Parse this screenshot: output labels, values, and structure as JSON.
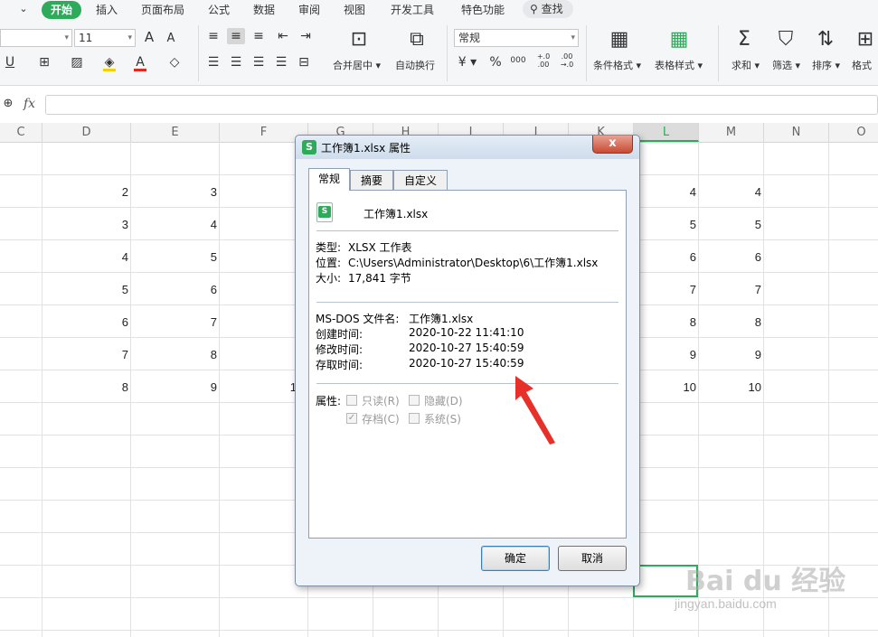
{
  "menu": {
    "tabs": [
      "开始",
      "插入",
      "页面布局",
      "公式",
      "数据",
      "审阅",
      "视图",
      "开发工具",
      "特色功能"
    ],
    "search": "查找"
  },
  "ribbon": {
    "font_size": "11",
    "number_format": "常规",
    "merge_center": "合并居中",
    "wrap_text": "自动换行",
    "currency_symbol": "¥",
    "percent_symbol": "%",
    "thousands_symbol": "000",
    "cond_format": "条件格式",
    "table_style": "表格样式",
    "sum": "求和",
    "filter": "筛选",
    "sort": "排序",
    "format": "格式",
    "font_grow": "A",
    "font_shrink": "A",
    "font_color_letter": "A",
    "decimal_inc": "+.0\n.00",
    "decimal_dec": ".00\n→.0"
  },
  "formula_bar": {
    "fx": "fx"
  },
  "grid": {
    "columns": [
      "C",
      "D",
      "E",
      "F",
      "G",
      "H",
      "I",
      "J",
      "K",
      "L",
      "M",
      "N",
      "O"
    ],
    "selected_column": "L",
    "col_d": [
      "2",
      "3",
      "4",
      "5",
      "6",
      "7",
      "8"
    ],
    "col_e": [
      "3",
      "4",
      "5",
      "6",
      "7",
      "8",
      "9"
    ],
    "col_f_partial": "1",
    "col_l": [
      "4",
      "5",
      "6",
      "7",
      "8",
      "9",
      "10"
    ],
    "col_m": [
      "4",
      "5",
      "6",
      "7",
      "8",
      "9",
      "10"
    ]
  },
  "dialog": {
    "title": "工作簿1.xlsx 属性",
    "app_icon_letter": "S",
    "close": "x",
    "tabs": [
      "常规",
      "摘要",
      "自定义"
    ],
    "file_name": "工作簿1.xlsx",
    "type_label": "类型:",
    "type_value": "XLSX 工作表",
    "location_label": "位置:",
    "location_value": "C:\\Users\\Administrator\\Desktop\\6\\工作簿1.xlsx",
    "size_label": "大小:",
    "size_value": "17,841 字节",
    "msdos_label": "MS-DOS 文件名:",
    "msdos_value": "工作簿1.xlsx",
    "created_label": "创建时间:",
    "created_value": "2020-10-22 11:41:10",
    "modified_label": "修改时间:",
    "modified_value": "2020-10-27 15:40:59",
    "accessed_label": "存取时间:",
    "accessed_value": "2020-10-27 15:40:59",
    "attributes_label": "属性:",
    "attr_readonly": "只读(R)",
    "attr_hidden": "隐藏(D)",
    "attr_archive": "存档(C)",
    "attr_system": "系统(S)",
    "ok": "确定",
    "cancel": "取消"
  },
  "colors": {
    "accent": "#2eaa5b",
    "arrow": "#e8302a"
  },
  "watermark": {
    "logo": "Bai du 经验",
    "url": "jingyan.baidu.com"
  }
}
